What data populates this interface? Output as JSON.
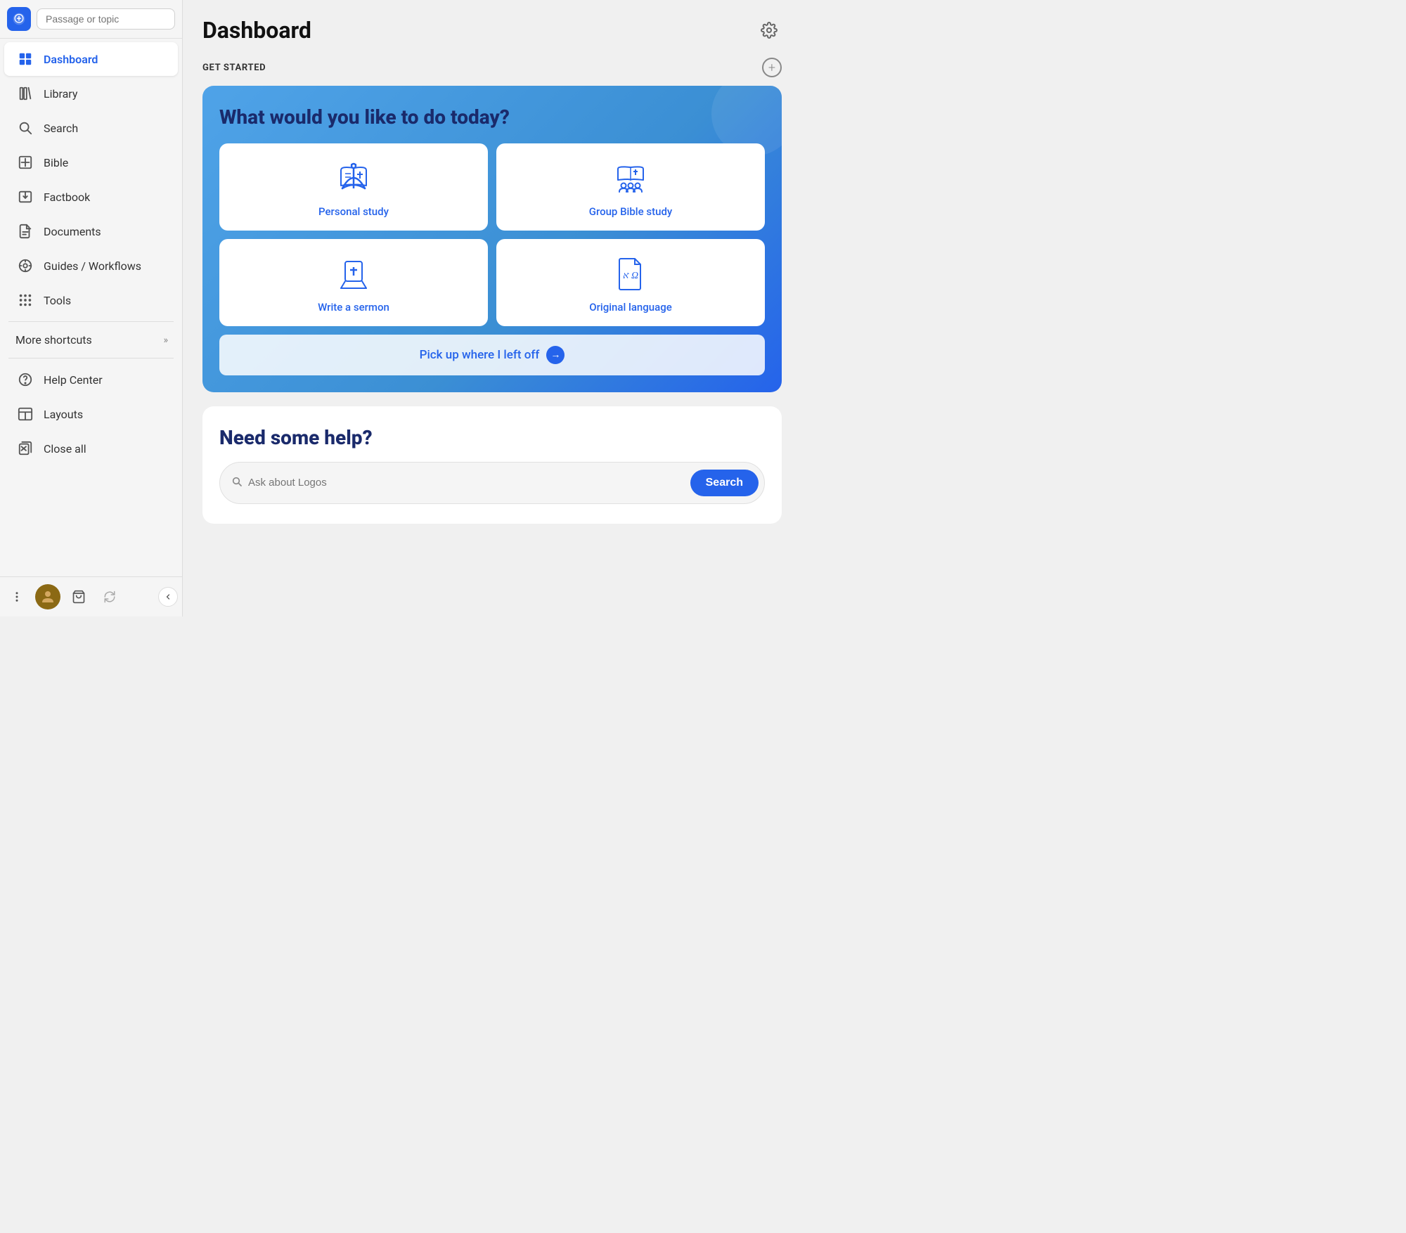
{
  "sidebar": {
    "search_placeholder": "Passage or topic",
    "nav_items": [
      {
        "id": "dashboard",
        "label": "Dashboard",
        "active": true
      },
      {
        "id": "library",
        "label": "Library",
        "active": false
      },
      {
        "id": "search",
        "label": "Search",
        "active": false
      },
      {
        "id": "bible",
        "label": "Bible",
        "active": false
      },
      {
        "id": "factbook",
        "label": "Factbook",
        "active": false
      },
      {
        "id": "documents",
        "label": "Documents",
        "active": false
      },
      {
        "id": "guides",
        "label": "Guides / Workflows",
        "active": false
      },
      {
        "id": "tools",
        "label": "Tools",
        "active": false
      }
    ],
    "more_shortcuts": "More shortcuts",
    "bottom": {
      "help_center": "Help Center",
      "layouts": "Layouts",
      "close_all": "Close all"
    }
  },
  "main": {
    "title": "Dashboard",
    "sections": {
      "get_started": {
        "label": "GET STARTED",
        "card_heading": "What would you like to do today?",
        "study_options": [
          {
            "id": "personal-study",
            "label": "Personal study"
          },
          {
            "id": "group-bible-study",
            "label": "Group Bible study"
          },
          {
            "id": "write-sermon",
            "label": "Write a sermon"
          },
          {
            "id": "original-language",
            "label": "Original language"
          }
        ],
        "pickup_label": "Pick up where I left off"
      },
      "help": {
        "heading": "Need some help?",
        "search_placeholder": "Ask about Logos",
        "search_btn": "Search"
      }
    }
  }
}
